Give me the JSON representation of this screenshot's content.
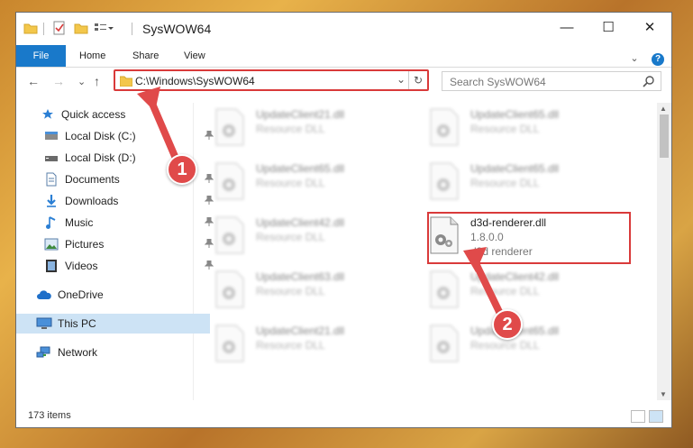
{
  "window": {
    "title": "SysWOW64",
    "minimize_glyph": "—",
    "maximize_glyph": "☐",
    "close_glyph": "✕"
  },
  "ribbon": {
    "tabs": [
      "File",
      "Home",
      "Share",
      "View"
    ],
    "expand_glyph": "⌄",
    "help_glyph": "?"
  },
  "nav": {
    "back_glyph": "←",
    "forward_glyph": "→",
    "recent_glyph": "⌄",
    "up_glyph": "↑"
  },
  "address": {
    "path": "C:\\Windows\\SysWOW64",
    "dropdown_glyph": "⌄",
    "refresh_glyph": "↻"
  },
  "search": {
    "placeholder": "Search SysWOW64"
  },
  "sidebar": {
    "items": [
      {
        "label": "Quick access",
        "icon": "star-icon",
        "pinned": false
      },
      {
        "label": "Local Disk (C:)",
        "icon": "drive-icon",
        "pinned": true
      },
      {
        "label": "Local Disk (D:)",
        "icon": "drive-icon",
        "pinned": false
      },
      {
        "label": "Documents",
        "icon": "document-icon",
        "pinned": true
      },
      {
        "label": "Downloads",
        "icon": "download-icon",
        "pinned": true
      },
      {
        "label": "Music",
        "icon": "music-icon",
        "pinned": true
      },
      {
        "label": "Pictures",
        "icon": "pictures-icon",
        "pinned": true
      },
      {
        "label": "Videos",
        "icon": "video-icon",
        "pinned": true
      },
      {
        "label": "OneDrive",
        "icon": "cloud-icon",
        "pinned": false
      },
      {
        "label": "This PC",
        "icon": "computer-icon",
        "pinned": false,
        "selected": true
      },
      {
        "label": "Network",
        "icon": "network-icon",
        "pinned": false
      }
    ],
    "pin_glyph": "📌"
  },
  "files": {
    "left": [
      {
        "name": "UpdateClient21.dll",
        "type": "Resource DLL"
      },
      {
        "name": "UpdateClient65.dll",
        "type": "Resource DLL"
      },
      {
        "name": "UpdateClient42.dll",
        "type": "Resource DLL"
      },
      {
        "name": "UpdateClient63.dll",
        "type": "Resource DLL"
      },
      {
        "name": "UpdateClient21.dll",
        "type": "Resource DLL"
      }
    ],
    "right": [
      {
        "name": "UpdateClient65.dll",
        "type": "Resource DLL"
      },
      {
        "name": "UpdateClient65.dll",
        "type": "Resource DLL"
      },
      {
        "name": "d3d-renderer.dll",
        "version": "1.8.0.0",
        "type": "d3d renderer",
        "highlighted": true
      },
      {
        "name": "UpdateClient42.dll",
        "type": "Resource DLL"
      },
      {
        "name": "UpdateClient65.dll",
        "type": "Resource DLL"
      }
    ]
  },
  "status": {
    "item_count": "173 items"
  },
  "annotations": {
    "step1": "1",
    "step2": "2",
    "color": "#e04a4a"
  },
  "colors": {
    "accent": "#1979ca",
    "highlight": "#d93a3a",
    "selected": "#cde3f5"
  }
}
